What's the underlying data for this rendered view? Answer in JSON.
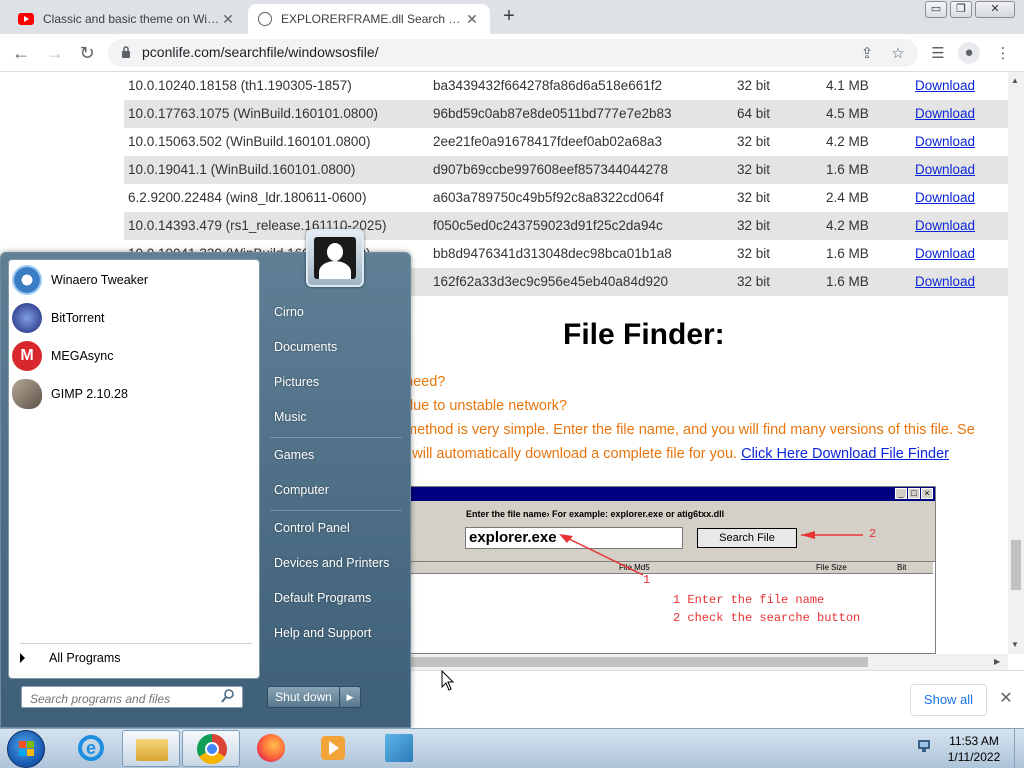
{
  "browser": {
    "tabs": [
      {
        "title": "Classic and basic theme on Wind",
        "icon": "youtube-icon",
        "active": false
      },
      {
        "title": "EXPLORERFRAME.dll Search Resu",
        "icon": "globe-icon",
        "active": true
      }
    ],
    "url": "pconlife.com/searchfile/windowsosfile/",
    "window_buttons": {
      "minimize": "▭",
      "restore": "❐",
      "close": "✕"
    }
  },
  "table": {
    "rows": [
      {
        "version": "10.0.10240.18158 (th1.190305-1857)",
        "md5": "ba3439432f664278fa86d6a518e661f2",
        "bit": "32 bit",
        "size": "4.1 MB",
        "link": "Download"
      },
      {
        "version": "10.0.17763.1075 (WinBuild.160101.0800)",
        "md5": "96bd59c0ab87e8de0511bd777e7e2b83",
        "bit": "64 bit",
        "size": "4.5 MB",
        "link": "Download"
      },
      {
        "version": "10.0.15063.502 (WinBuild.160101.0800)",
        "md5": "2ee21fe0a91678417fdeef0ab02a68a3",
        "bit": "32 bit",
        "size": "4.2 MB",
        "link": "Download"
      },
      {
        "version": "10.0.19041.1 (WinBuild.160101.0800)",
        "md5": "d907b69ccbe997608eef857344044278",
        "bit": "32 bit",
        "size": "1.6 MB",
        "link": "Download"
      },
      {
        "version": "6.2.9200.22484 (win8_ldr.180611-0600)",
        "md5": "a603a789750c49b5f92c8a8322cd064f",
        "bit": "32 bit",
        "size": "2.4 MB",
        "link": "Download"
      },
      {
        "version": "10.0.14393.479 (rs1_release.161110-2025)",
        "md5": "f050c5ed0c243759023d91f25c2da94c",
        "bit": "32 bit",
        "size": "4.2 MB",
        "link": "Download"
      },
      {
        "version": "10.0.19041.330 (WinBuild.160101.0800)",
        "md5": "bb8d9476341d313048dec98bca01b1a8",
        "bit": "32 bit",
        "size": "1.6 MB",
        "link": "Download"
      },
      {
        "version": "",
        "md5": "162f62a33d3ec9c956e45eb40a84d920",
        "bit": "32 bit",
        "size": "1.6 MB",
        "link": "Download"
      }
    ]
  },
  "file_finder": {
    "title": "File Finder:",
    "line1": "need?",
    "line2": "due to unstable network?",
    "line3": "method is very simple. Enter the file name, and you will find many versions of this file. Se",
    "line4": "l will automatically download a complete file for you.",
    "link": "Click Here Download File Finder",
    "image": {
      "hint": "Enter the file name›  For example: explorer.exe or atig6txx.dll",
      "input_value": "explorer.exe",
      "button": "Search File",
      "col_md5": "File Md5",
      "col_size": "File Size",
      "col_bit": "Bit",
      "num1": "1",
      "num2": "2",
      "instr1": "1 Enter the file name",
      "instr2": "2 check the searche button"
    }
  },
  "downloads_bar": {
    "show_all": "Show all"
  },
  "start_menu": {
    "programs": [
      {
        "name": "Winaero Tweaker",
        "icon": "winaero-icon",
        "color": "#3b7dc4"
      },
      {
        "name": "BitTorrent",
        "icon": "bittorrent-icon",
        "color": "#3a4a9a"
      },
      {
        "name": "MEGAsync",
        "icon": "mega-icon",
        "color": "#d9272e"
      },
      {
        "name": "GIMP 2.10.28",
        "icon": "gimp-icon",
        "color": "#6b5d4f"
      }
    ],
    "all_programs": "All Programs",
    "search_placeholder": "Search programs and files",
    "right_links": [
      "Cirno",
      "Documents",
      "Pictures",
      "Music",
      "Games",
      "Computer",
      "Control Panel",
      "Devices and Printers",
      "Default Programs",
      "Help and Support"
    ],
    "shutdown": "Shut down"
  },
  "taskbar": {
    "items": [
      "start-orb",
      "internet-explorer-icon",
      "file-explorer-icon",
      "chrome-icon",
      "firefox-icon",
      "media-player-icon",
      "taskbar-app-icon"
    ],
    "time": "11:53 AM",
    "date": "1/11/2022"
  }
}
